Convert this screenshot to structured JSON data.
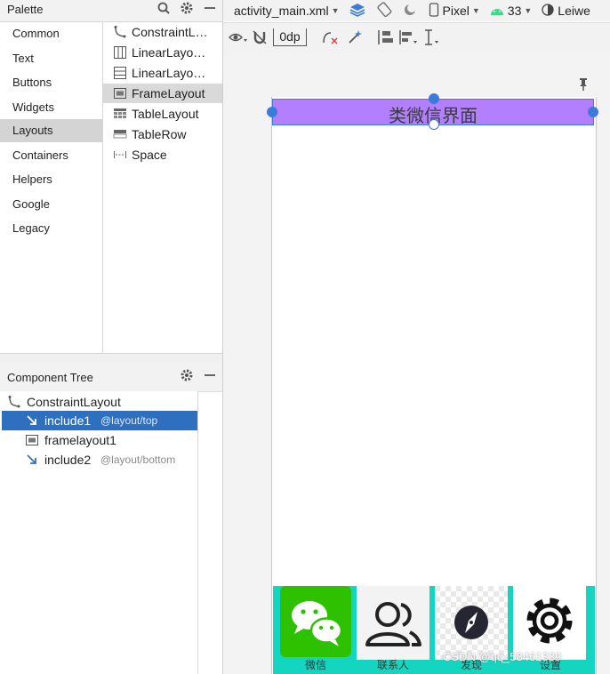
{
  "palette": {
    "title": "Palette",
    "categories": [
      "Common",
      "Text",
      "Buttons",
      "Widgets",
      "Layouts",
      "Containers",
      "Helpers",
      "Google",
      "Legacy"
    ],
    "selected_category": "Layouts",
    "widgets": [
      {
        "label": "ConstraintL…",
        "icon": "constraint-layout-icon"
      },
      {
        "label": "LinearLayo…",
        "icon": "linear-layout-vertical-icon"
      },
      {
        "label": "LinearLayo…",
        "icon": "linear-layout-horizontal-icon"
      },
      {
        "label": "FrameLayout",
        "icon": "frame-layout-icon"
      },
      {
        "label": "TableLayout",
        "icon": "table-layout-icon"
      },
      {
        "label": "TableRow",
        "icon": "table-row-icon"
      },
      {
        "label": "Space",
        "icon": "space-icon"
      }
    ],
    "selected_widget": "FrameLayout"
  },
  "component_tree": {
    "title": "Component Tree",
    "rows": [
      {
        "label": "ConstraintLayout",
        "meta": ""
      },
      {
        "label": "include1",
        "meta": "@layout/top"
      },
      {
        "label": "framelayout1",
        "meta": ""
      },
      {
        "label": "include2",
        "meta": "@layout/bottom"
      }
    ]
  },
  "toolbar": {
    "file": "activity_main.xml",
    "device": "Pixel",
    "api": "33",
    "theme": "Leiwe",
    "default_margin": "0dp"
  },
  "canvas": {
    "top_title": "类微信界面",
    "tabs": [
      "微信",
      "联系人",
      "发现",
      "设置"
    ]
  },
  "watermark": "CSDN @qq_58461339",
  "colors": {
    "top_bar": "#b17fff",
    "bottom_bar": "#14d6c0",
    "selection": "#3d7bd9",
    "tree_selected": "#2f6fc0",
    "wechat_green": "#2dc100"
  }
}
